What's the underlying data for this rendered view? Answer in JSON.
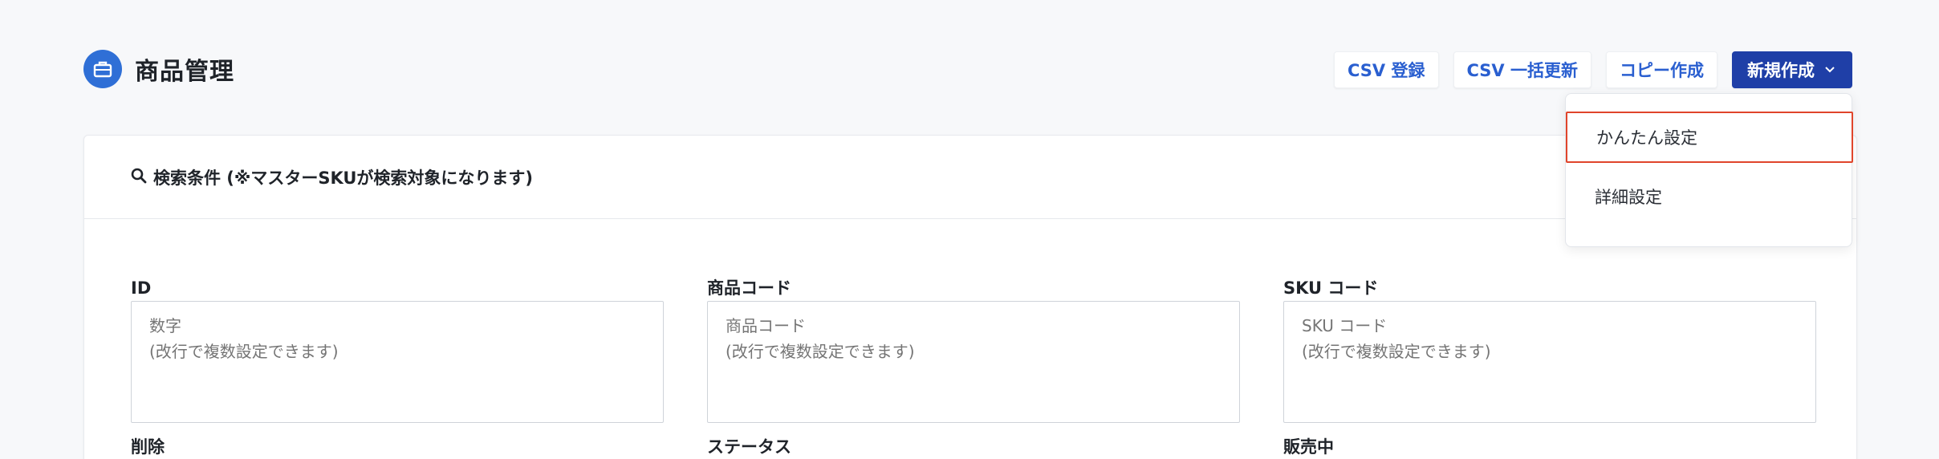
{
  "header": {
    "title": "商品管理",
    "icon": "briefcase-icon",
    "accent": "#2f6fd6"
  },
  "actions": {
    "csv_register": "CSV 登録",
    "csv_bulk_update": "CSV 一括更新",
    "copy_create": "コピー作成",
    "new_create": "新規作成"
  },
  "dropdown": {
    "items": [
      {
        "label": "かんたん設定",
        "highlighted": true
      },
      {
        "label": "詳細設定"
      }
    ]
  },
  "search": {
    "title": "検索条件 (※マスターSKUが検索対象になります)",
    "fields": [
      {
        "label": "ID",
        "placeholder": "数字\n(改行で複数設定できます)"
      },
      {
        "label": "商品コード",
        "placeholder": "商品コード\n(改行で複数設定できます)"
      },
      {
        "label": "SKU コード",
        "placeholder": "SKU コード\n(改行で複数設定できます)"
      }
    ],
    "row2_labels": [
      "削除",
      "ステータス",
      "販売中"
    ]
  },
  "colors": {
    "primary_button": "#1f3fa7",
    "link_button_text": "#2a5fd0",
    "highlight_border": "#e0452b"
  }
}
